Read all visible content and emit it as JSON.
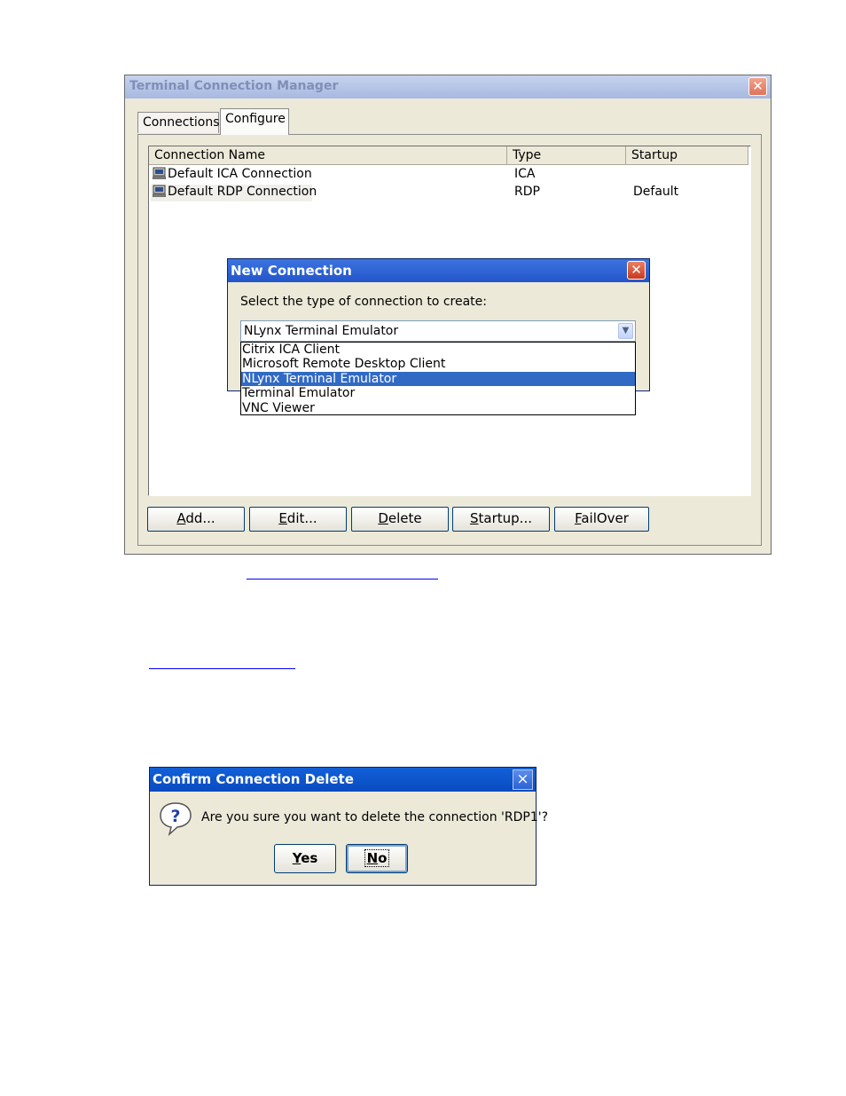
{
  "tcm": {
    "title": "Terminal Connection Manager",
    "close_glyph": "✕",
    "tabs": [
      {
        "label": "Connections"
      },
      {
        "label": "Configure"
      }
    ],
    "columns": [
      "Connection Name",
      "Type",
      "Startup"
    ],
    "rows": [
      {
        "name": "Default ICA Connection",
        "type": "ICA",
        "startup": ""
      },
      {
        "name": "Default RDP Connection",
        "type": "RDP",
        "startup": "Default"
      }
    ],
    "buttons": [
      {
        "mnemonic": "A",
        "rest": "dd..."
      },
      {
        "mnemonic": "E",
        "rest": "dit..."
      },
      {
        "mnemonic": "D",
        "rest": "elete"
      },
      {
        "mnemonic": "S",
        "rest": "tartup..."
      },
      {
        "mnemonic": "F",
        "rest": "ailOver"
      }
    ],
    "row_icon": "computer-icon"
  },
  "new_connection": {
    "title": "New Connection",
    "close_glyph": "✕",
    "prompt": "Select the type of connection to create:",
    "selected": "NLynx Terminal Emulator",
    "options": [
      "Citrix ICA Client",
      "Microsoft Remote Desktop Client",
      "NLynx Terminal Emulator",
      "Terminal Emulator",
      "VNC Viewer"
    ],
    "arrow_glyph": "▼"
  },
  "confirm": {
    "title": "Confirm Connection Delete",
    "close_glyph": "×",
    "message": "Are you sure you want to delete the connection 'RDP1'?",
    "icon": "question-icon",
    "yes": {
      "mnemonic": "Y",
      "rest": "es"
    },
    "no": {
      "mnemonic": "N",
      "rest": "o"
    }
  },
  "colors": {
    "dialog_bg": "#ece9d8",
    "title_active": "#2356c9",
    "selection": "#316ac5",
    "link": "#0000ff"
  }
}
